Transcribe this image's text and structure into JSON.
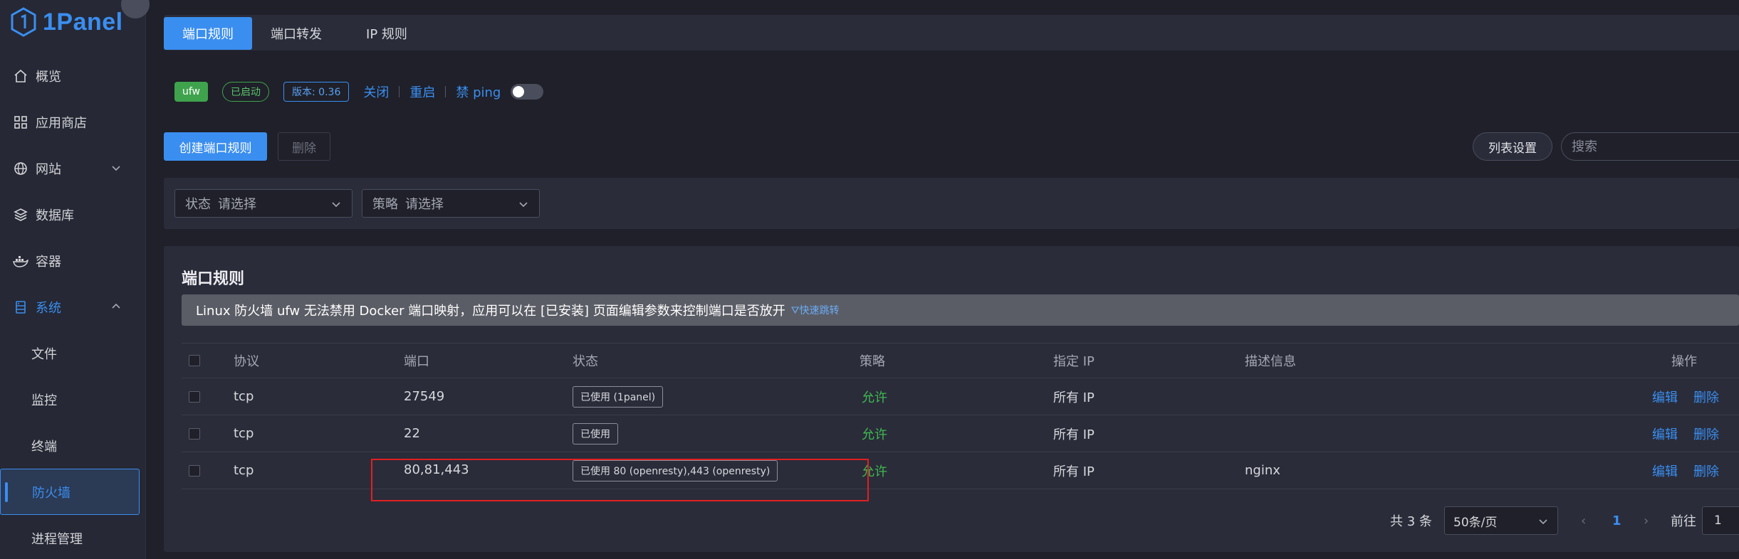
{
  "app": {
    "logo_text": "1Panel"
  },
  "sidebar": {
    "items": [
      {
        "label": "概览",
        "icon": "home-icon"
      },
      {
        "label": "应用商店",
        "icon": "grid-icon"
      },
      {
        "label": "网站",
        "icon": "globe-icon"
      },
      {
        "label": "数据库",
        "icon": "layers-icon"
      },
      {
        "label": "容器",
        "icon": "docker-icon"
      },
      {
        "label": "系统",
        "icon": "server-icon"
      },
      {
        "label": "文件"
      },
      {
        "label": "监控"
      },
      {
        "label": "终端"
      },
      {
        "label": "防火墙"
      },
      {
        "label": "进程管理"
      }
    ]
  },
  "tabs": [
    {
      "label": "端口规则"
    },
    {
      "label": "端口转发"
    },
    {
      "label": "IP 规则"
    }
  ],
  "status": {
    "firewall_name": "ufw",
    "state": "已启动",
    "version": "版本: 0.36",
    "stop": "关闭",
    "restart": "重启",
    "ping_label": "禁 ping"
  },
  "toolbar": {
    "create": "创建端口规则",
    "delete": "删除",
    "columns": "列表设置",
    "search_placeholder": "搜索"
  },
  "filters": [
    {
      "prefix": "状态",
      "placeholder": "请选择"
    },
    {
      "prefix": "策略",
      "placeholder": "请选择"
    }
  ],
  "table": {
    "title": "端口规则",
    "alert": "Linux 防火墙 ufw 无法禁用 Docker 端口映射，应用可以在 [已安装] 页面编辑参数来控制端口是否放开",
    "alert_link": "快速跳转",
    "headers": {
      "protocol": "协议",
      "port": "端口",
      "status": "状态",
      "strategy": "策略",
      "ip": "指定 IP",
      "desc": "描述信息",
      "ops": "操作"
    },
    "rows": [
      {
        "protocol": "tcp",
        "port": "27549",
        "status": "已使用 (1panel)",
        "strategy": "允许",
        "ip": "所有 IP",
        "desc": "",
        "edit": "编辑",
        "del": "删除"
      },
      {
        "protocol": "tcp",
        "port": "22",
        "status": "已使用",
        "strategy": "允许",
        "ip": "所有 IP",
        "desc": "",
        "edit": "编辑",
        "del": "删除"
      },
      {
        "protocol": "tcp",
        "port": "80,81,443",
        "status": "已使用 80 (openresty),443 (openresty)",
        "strategy": "允许",
        "ip": "所有 IP",
        "desc": "nginx",
        "edit": "编辑",
        "del": "删除"
      }
    ]
  },
  "pagination": {
    "total": "共 3 条",
    "page_size": "50条/页",
    "current": "1",
    "goto_label": "前往",
    "goto_value": "1"
  },
  "colors": {
    "accent": "#3a8ef0",
    "success": "#3fb950",
    "highlight": "#e02020"
  }
}
